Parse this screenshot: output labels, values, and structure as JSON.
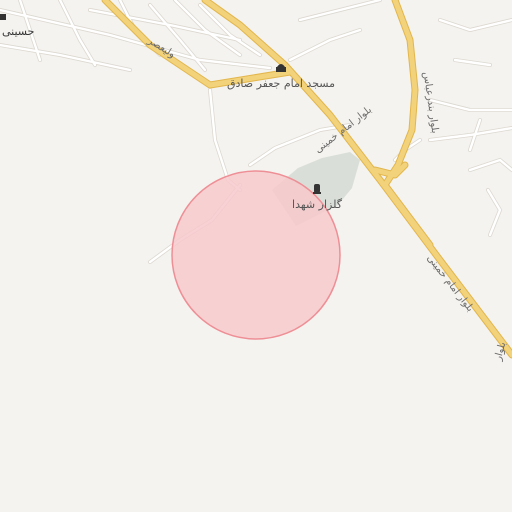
{
  "map": {
    "type": "street-map",
    "colors": {
      "background": "#f5f3ef",
      "highway": "#f2d27a",
      "highway_casing": "#e2b64d",
      "minor_road": "#ffffff",
      "minor_road_casing": "#dcd8d0",
      "park": "#d9dfd8",
      "highlight_circle_fill": "#f7c9cc",
      "highlight_circle_stroke": "#ee8f96"
    }
  },
  "labels": {
    "edge_top_left": "حسینی",
    "street_valiasr": "ولیعصر",
    "mosque_name": "مسجد امام جعفر صادق",
    "boulevard_top": "بلوار امام خمینی",
    "boulevard_bottom": "بلوار امام خمینی",
    "boulevard_edge": "بلوار",
    "bypass_road": "بلوار بندرعباس",
    "cemetery_name": "گلزار شهدا"
  },
  "pois": [
    {
      "name_ref": "mosque_name",
      "icon": "mosque-icon"
    },
    {
      "name_ref": "cemetery_name",
      "icon": "cemetery-icon"
    }
  ],
  "highlight": {
    "shape": "circle",
    "description_ref": "selected-area"
  }
}
